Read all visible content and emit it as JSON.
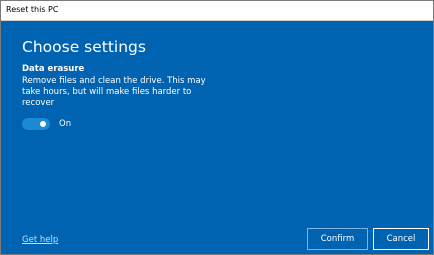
{
  "window": {
    "title": "Reset this PC"
  },
  "page": {
    "heading": "Choose settings",
    "section_title": "Data erasure",
    "description": "Remove files and clean the drive. This may take hours, but will make files harder to recover",
    "toggle": {
      "state": "On",
      "checked": true
    },
    "help_link": "Get help"
  },
  "buttons": {
    "confirm": "Confirm",
    "cancel": "Cancel"
  },
  "colors": {
    "panel_background": "#0063b1",
    "toggle_on": "#1a8ad4",
    "link": "#bfe0ff"
  }
}
